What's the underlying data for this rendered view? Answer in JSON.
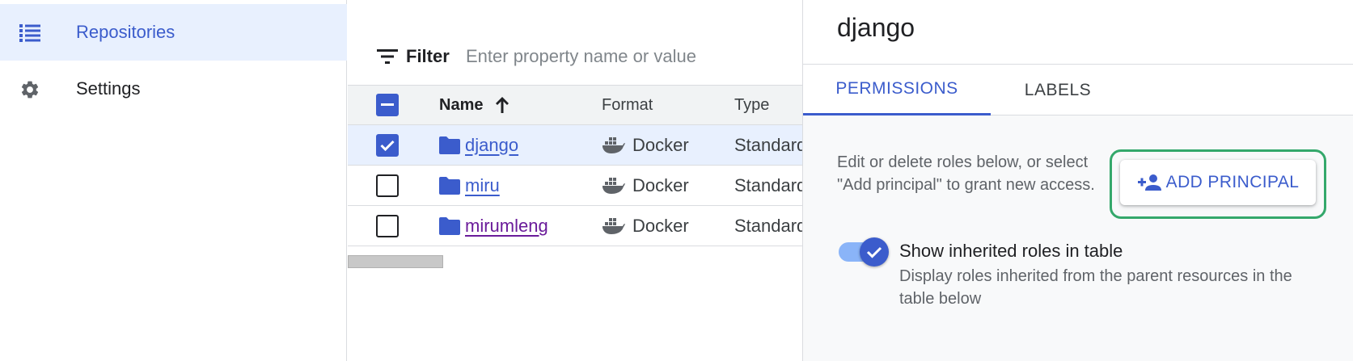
{
  "sidebar": {
    "items": [
      {
        "label": "Repositories",
        "icon": "list-icon",
        "active": true
      },
      {
        "label": "Settings",
        "icon": "gear-icon",
        "active": false
      }
    ]
  },
  "filter": {
    "label": "Filter",
    "placeholder": "Enter property name or value"
  },
  "table": {
    "columns": [
      "Name",
      "Format",
      "Type"
    ],
    "sort": {
      "column": "Name",
      "direction": "ascending"
    },
    "rows": [
      {
        "name": "django",
        "format": "Docker",
        "type": "Standard",
        "checked": true
      },
      {
        "name": "miru",
        "format": "Docker",
        "type": "Standard",
        "checked": false
      },
      {
        "name": "mirumleng",
        "format": "Docker",
        "type": "Standard",
        "checked": false
      }
    ]
  },
  "panel": {
    "title": "django",
    "tabs": [
      "PERMISSIONS",
      "LABELS"
    ],
    "active_tab": "PERMISSIONS",
    "description": "Edit or delete roles below, or select \"Add principal\" to grant new access.",
    "add_button": "ADD PRINCIPAL",
    "toggle": {
      "on": true,
      "title": "Show inherited roles in table",
      "description": "Display roles inherited from the parent resources in the table below"
    }
  },
  "colors": {
    "accent": "#3b5ccc",
    "highlight_border": "#34a86b",
    "selected_row": "#e8f0fe",
    "visited_link": "#6a1b9a"
  }
}
